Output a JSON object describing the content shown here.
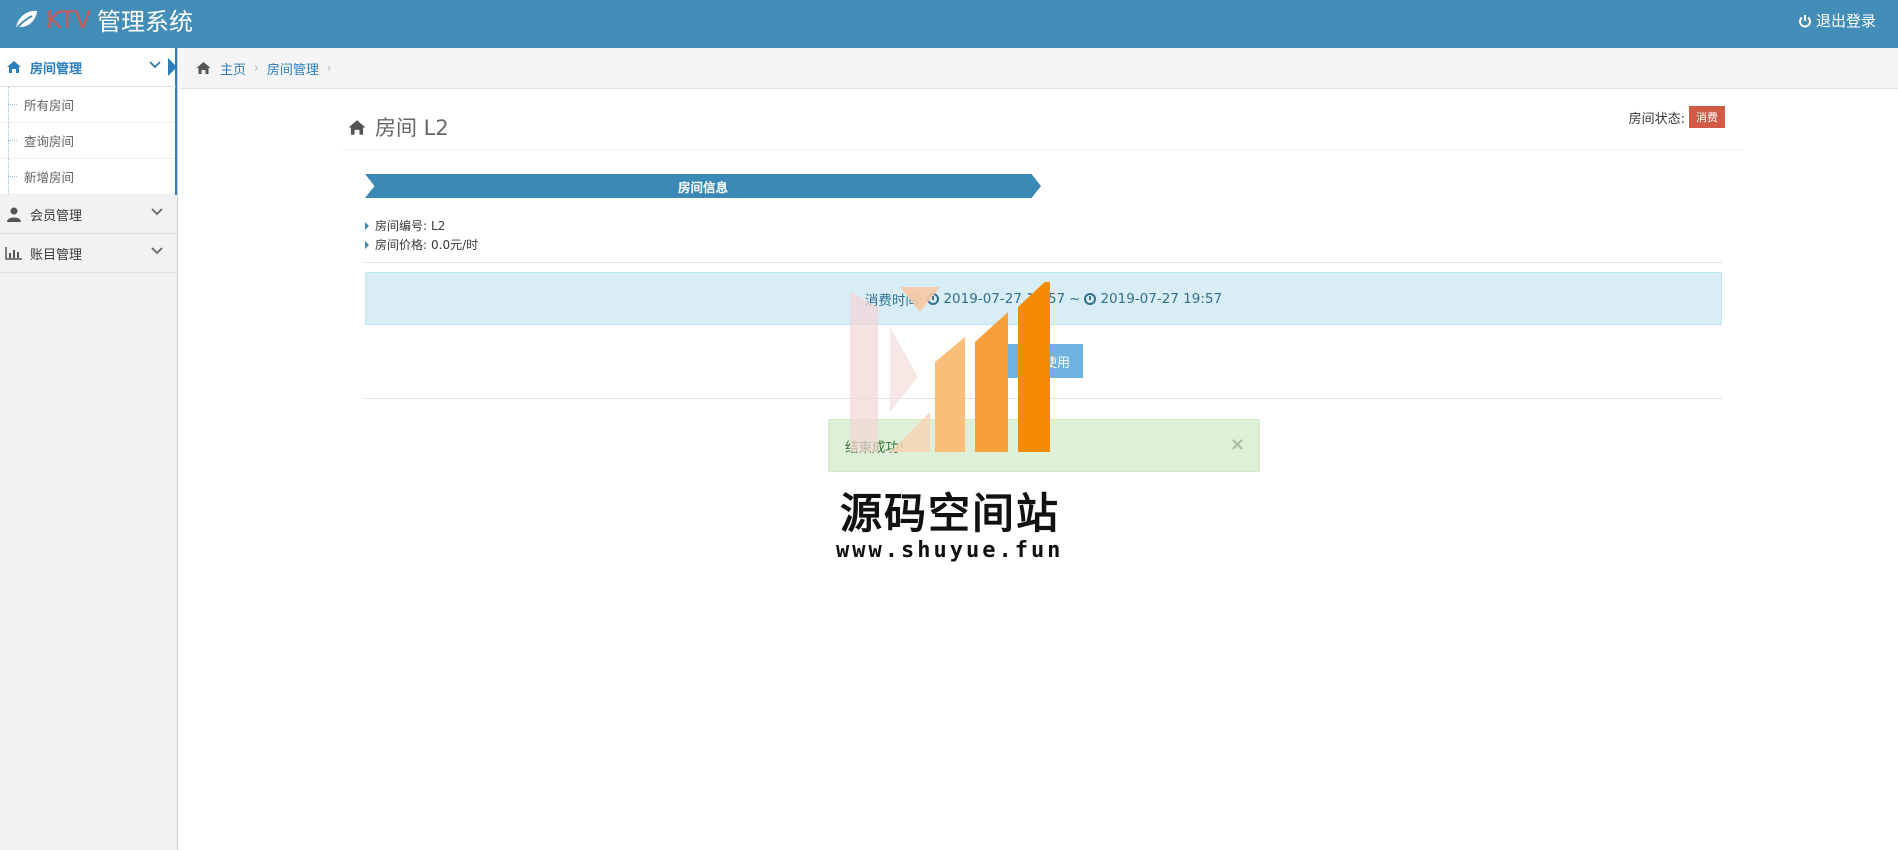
{
  "header": {
    "brand_prefix": "KTV",
    "brand_title": "管理系统",
    "logout_label": "退出登录"
  },
  "sidebar": {
    "items": [
      {
        "label": "房间管理",
        "icon": "home-icon",
        "active": true,
        "children": [
          {
            "label": "所有房间"
          },
          {
            "label": "查询房间"
          },
          {
            "label": "新增房间"
          }
        ]
      },
      {
        "label": "会员管理",
        "icon": "user-icon"
      },
      {
        "label": "账目管理",
        "icon": "bar-chart-icon"
      }
    ]
  },
  "breadcrumb": {
    "home": "主页",
    "current": "房间管理"
  },
  "page": {
    "title": "房间 L2",
    "status_label": "房间状态:",
    "status_badge": "消费",
    "section_title": "房间信息",
    "info": [
      {
        "label": "房间编号:",
        "value": "L2"
      },
      {
        "label": "房间价格:",
        "value": "0.0元/时"
      }
    ],
    "consume_label": "消费时间:",
    "consume_start": "2019-07-27 19:57",
    "consume_separator": "~",
    "consume_end": "2019-07-27 19:57",
    "end_button": "结束使用",
    "success_message": "结束成功!"
  },
  "watermark": {
    "title": "源码空间站",
    "url": "www.shuyue.fun"
  },
  "colors": {
    "navbar": "#438eb9",
    "accent": "#2b7dbc",
    "ribbon": "#3a89b6",
    "badge": "#d15b47",
    "info_bg": "#d9edf7",
    "success_bg": "#dff0d8",
    "button": "#6fb3e0"
  }
}
